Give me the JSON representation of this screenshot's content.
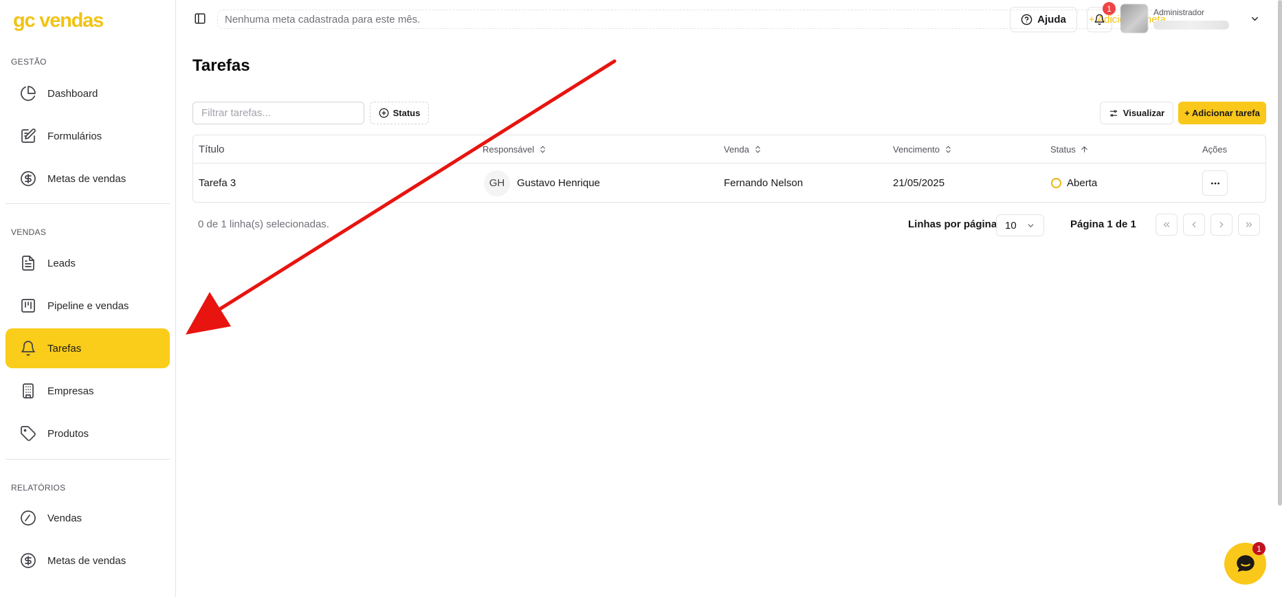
{
  "app": {
    "logo": "gc vendas"
  },
  "sidebar": {
    "sections": [
      {
        "label": "GESTÃO"
      },
      {
        "label": "VENDAS"
      },
      {
        "label": "RELATÓRIOS"
      }
    ],
    "items": [
      {
        "label": "Dashboard",
        "icon": "pie-chart-icon"
      },
      {
        "label": "Formulários",
        "icon": "file-edit-icon"
      },
      {
        "label": "Metas de vendas",
        "icon": "dollar-circle-icon"
      },
      {
        "label": "Leads",
        "icon": "document-icon"
      },
      {
        "label": "Pipeline e vendas",
        "icon": "kanban-icon"
      },
      {
        "label": "Tarefas",
        "icon": "bell-icon",
        "active": true
      },
      {
        "label": "Empresas",
        "icon": "building-icon"
      },
      {
        "label": "Produtos",
        "icon": "tag-icon"
      },
      {
        "label": "Vendas",
        "icon": "gauge-icon"
      },
      {
        "label": "Metas de vendas",
        "icon": "dollar-circle-icon"
      }
    ]
  },
  "topbar": {
    "goal_text": "Nenhuma meta cadastrada para este mês.",
    "goal_add": "+ Adicionar meta",
    "help_label": "Ajuda",
    "notification_count": "1",
    "user_role": "Administrador"
  },
  "main": {
    "title": "Tarefas",
    "filter_placeholder": "Filtrar tarefas...",
    "status_filter_label": "Status",
    "view_label": "Visualizar",
    "add_task_label": "+ Adicionar tarefa",
    "table": {
      "columns": [
        "Título",
        "Responsável",
        "Venda",
        "Vencimento",
        "Status",
        "Ações"
      ],
      "rows": [
        {
          "title": "Tarefa 3",
          "assignee_initials": "GH",
          "assignee": "Gustavo Henrique",
          "sale": "Fernando Nelson",
          "due": "21/05/2025",
          "status": "Aberta",
          "actions": "···"
        }
      ]
    },
    "footer": {
      "selected": "0 de 1 linha(s) selecionadas.",
      "rows_per_page_label": "Linhas por página",
      "rows_per_page_value": "10",
      "page_info": "Página 1 de 1"
    }
  },
  "chat": {
    "badge": "1"
  },
  "colors": {
    "accent": "#f9c81b",
    "logo": "#f2c315",
    "danger": "#ef4444",
    "arrow": "#e8140f"
  }
}
